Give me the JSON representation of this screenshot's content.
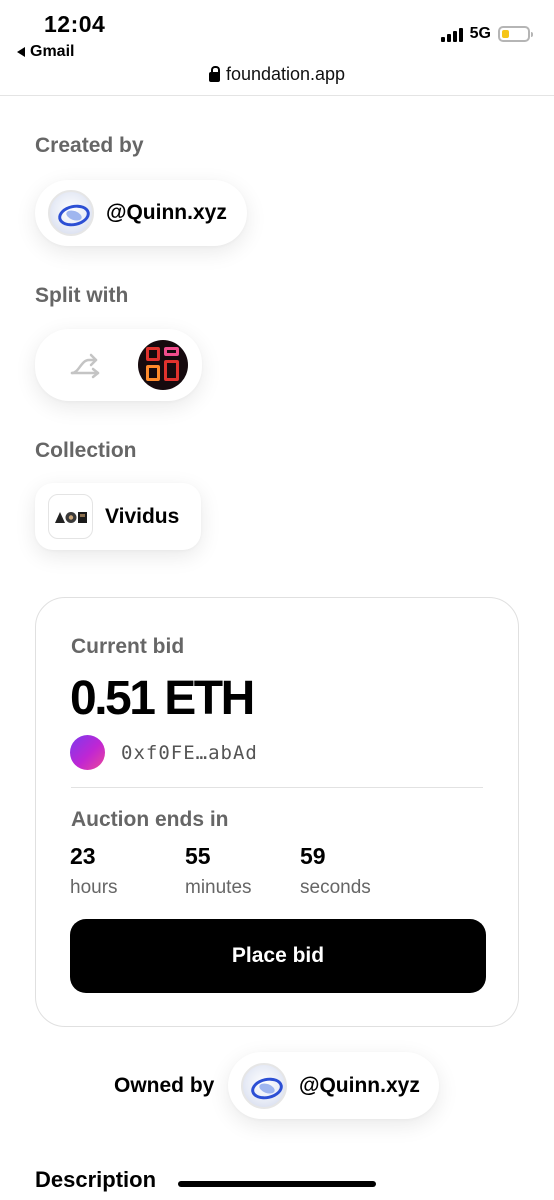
{
  "status_bar": {
    "time": "12:04",
    "back_app": "Gmail",
    "network": "5G",
    "battery_color": "#f5c518"
  },
  "browser": {
    "url": "foundation.app",
    "lock_icon": "lock-icon"
  },
  "created_by": {
    "label": "Created by",
    "username": "@Quinn.xyz"
  },
  "split_with": {
    "label": "Split with",
    "split_icon": "split-arrow-icon"
  },
  "collection": {
    "label": "Collection",
    "name": "Vividus"
  },
  "auction": {
    "current_bid_label": "Current bid",
    "current_bid": "0.51 ETH",
    "bidder_address": "0xf0FE…abAd",
    "ends_in_label": "Auction ends in",
    "countdown": [
      {
        "value": "23",
        "unit": "hours"
      },
      {
        "value": "55",
        "unit": "minutes"
      },
      {
        "value": "59",
        "unit": "seconds"
      }
    ],
    "place_bid_label": "Place bid"
  },
  "owned_by": {
    "label": "Owned by",
    "username": "@Quinn.xyz"
  },
  "description": {
    "label": "Description"
  },
  "colors": {
    "accent": "#000000",
    "muted_text": "#666666",
    "bidder_gradient_start": "#7c3aed",
    "bidder_gradient_end": "#ec4899"
  }
}
